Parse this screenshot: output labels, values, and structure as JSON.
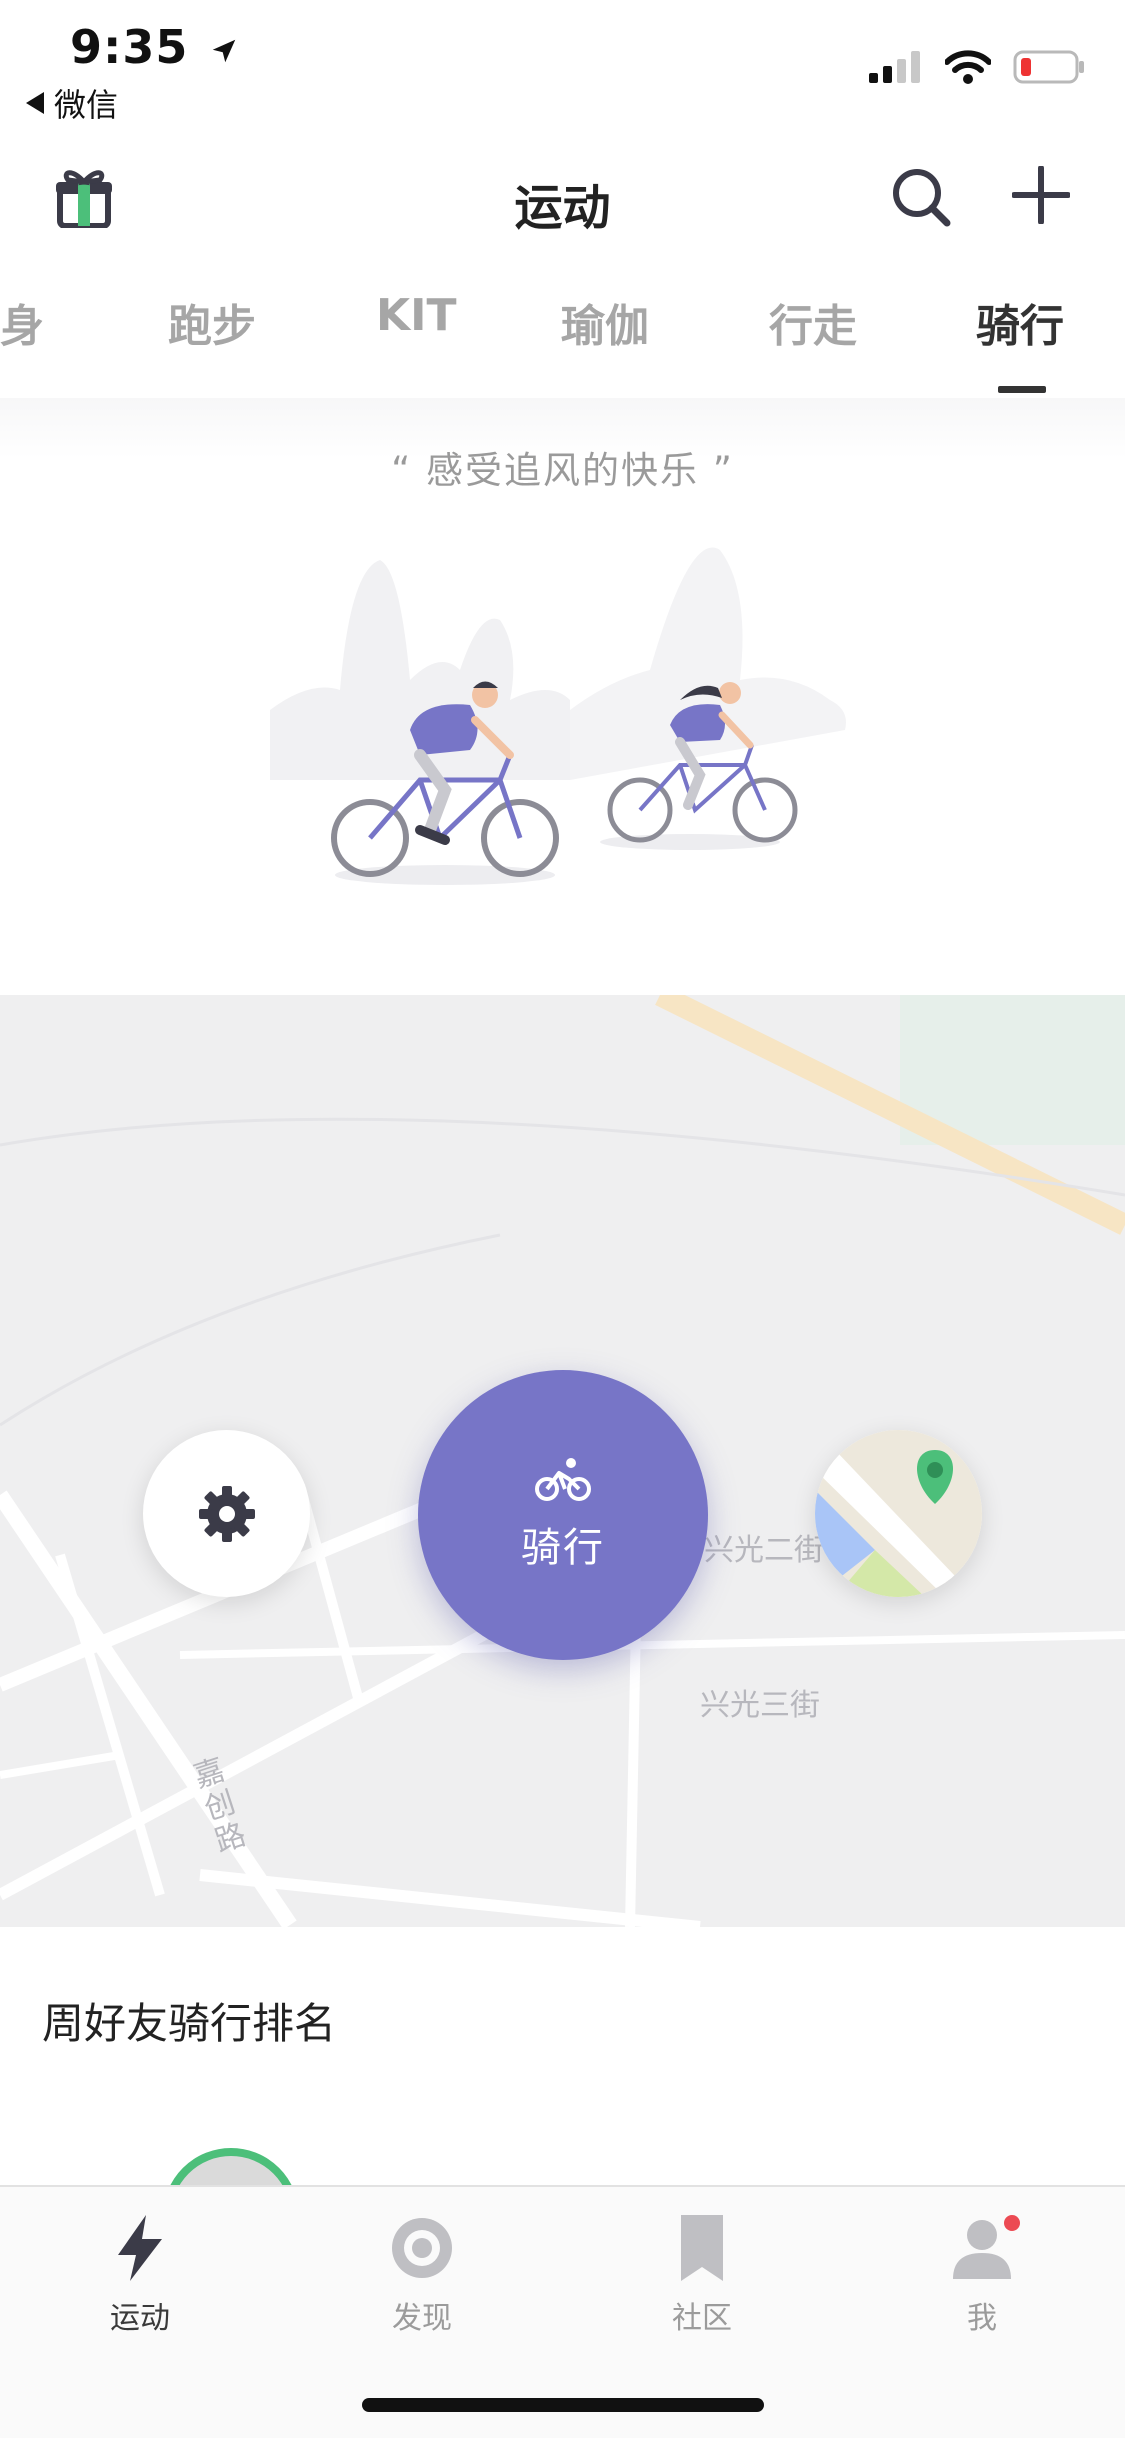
{
  "status_bar": {
    "time": "9:35",
    "back_app": "微信"
  },
  "header": {
    "title": "运动",
    "icons": [
      "gift-icon",
      "search-icon",
      "plus-icon"
    ]
  },
  "tabs": [
    {
      "label": "健身",
      "active": false
    },
    {
      "label": "跑步",
      "active": false
    },
    {
      "label": "KIT",
      "active": false
    },
    {
      "label": "瑜伽",
      "active": false
    },
    {
      "label": "行走",
      "active": false
    },
    {
      "label": "骑行",
      "active": true
    }
  ],
  "hero": {
    "slogan": "“ 感受追风的快乐 ”"
  },
  "map": {
    "streets": [
      "兴光二街",
      "兴光三街",
      "嘉创路"
    ],
    "start_button_label": "骑行",
    "icons": [
      "settings-icon",
      "bike-icon",
      "map-icon"
    ],
    "accent_color": "#7775c7"
  },
  "ranking": {
    "title": "周好友骑行排名"
  },
  "tabbar": {
    "items": [
      {
        "label": "运动",
        "icon": "lightning-icon",
        "active": true
      },
      {
        "label": "发现",
        "icon": "target-icon",
        "active": false
      },
      {
        "label": "社区",
        "icon": "bookmark-icon",
        "active": false
      },
      {
        "label": "我",
        "icon": "user-icon",
        "active": false,
        "badge": true
      }
    ]
  }
}
